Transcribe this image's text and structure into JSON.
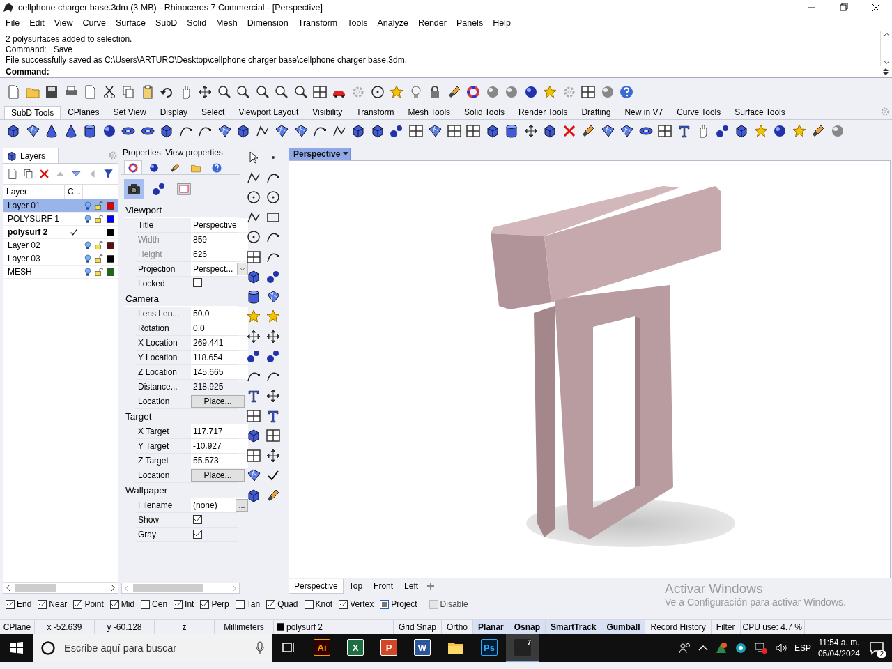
{
  "window": {
    "title": "cellphone charger base.3dm (3 MB) - Rhinoceros 7 Commercial - [Perspective]"
  },
  "menu": [
    "File",
    "Edit",
    "View",
    "Curve",
    "Surface",
    "SubD",
    "Solid",
    "Mesh",
    "Dimension",
    "Transform",
    "Tools",
    "Analyze",
    "Render",
    "Panels",
    "Help"
  ],
  "command_history": [
    "2 polysurfaces added to selection.",
    "Command: _Save",
    "File successfully saved as C:\\Users\\ARTURO\\Desktop\\cellphone charger base\\cellphone charger base.3dm."
  ],
  "command_prompt": "Command:",
  "toolbar_tabs": [
    {
      "label": "SubD Tools",
      "selected": true
    },
    {
      "label": "CPlanes",
      "selected": false
    },
    {
      "label": "Set View",
      "selected": false
    },
    {
      "label": "Display",
      "selected": false
    },
    {
      "label": "Select",
      "selected": false
    },
    {
      "label": "Viewport Layout",
      "selected": false
    },
    {
      "label": "Visibility",
      "selected": false
    },
    {
      "label": "Transform",
      "selected": false
    },
    {
      "label": "Mesh Tools",
      "selected": false
    },
    {
      "label": "Solid Tools",
      "selected": false
    },
    {
      "label": "Render Tools",
      "selected": false
    },
    {
      "label": "Drafting",
      "selected": false
    },
    {
      "label": "New in V7",
      "selected": false
    },
    {
      "label": "Curve Tools",
      "selected": false
    },
    {
      "label": "Surface Tools",
      "selected": false
    }
  ],
  "layers": {
    "title": "Layers",
    "columns": [
      "Layer",
      "C..."
    ],
    "rows": [
      {
        "name": "Layer 01",
        "selected": true,
        "current": false,
        "color": "#e00000"
      },
      {
        "name": "POLYSURF 1",
        "selected": false,
        "current": false,
        "color": "#0000ff"
      },
      {
        "name": "polysurf 2",
        "selected": false,
        "current": true,
        "color": "#000000"
      },
      {
        "name": "Layer 02",
        "selected": false,
        "current": false,
        "color": "#5a1010"
      },
      {
        "name": "Layer 03",
        "selected": false,
        "current": false,
        "color": "#000000"
      },
      {
        "name": "MESH",
        "selected": false,
        "current": false,
        "color": "#1a6a1a"
      }
    ]
  },
  "properties": {
    "title": "Properties: View properties",
    "tabs": [
      {
        "kind": "wheel",
        "selected": true
      },
      {
        "kind": "sphere",
        "selected": false
      },
      {
        "kind": "brush",
        "selected": false
      },
      {
        "kind": "folder",
        "selected": false
      },
      {
        "kind": "help",
        "selected": false
      }
    ],
    "pages": [
      {
        "kind": "camera",
        "selected": true
      },
      {
        "kind": "spheres",
        "selected": false
      },
      {
        "kind": "frame",
        "selected": false
      }
    ],
    "sections": [
      {
        "heading": "Viewport",
        "rows": [
          {
            "label": "Title",
            "kind": "text",
            "value": "Perspective",
            "disabled": false
          },
          {
            "label": "Width",
            "kind": "text",
            "value": "859",
            "disabled": true
          },
          {
            "label": "Height",
            "kind": "text",
            "value": "626",
            "disabled": true
          },
          {
            "label": "Projection",
            "kind": "dropdown",
            "value": "Perspect...",
            "disabled": false
          },
          {
            "label": "Locked",
            "kind": "checkbox",
            "checked": false,
            "disabled": false
          }
        ]
      },
      {
        "heading": "Camera",
        "rows": [
          {
            "label": "Lens Len...",
            "kind": "text",
            "value": "50.0",
            "disabled": false
          },
          {
            "label": "Rotation",
            "kind": "text",
            "value": "0.0",
            "disabled": false
          },
          {
            "label": "X Location",
            "kind": "text",
            "value": "269.441",
            "disabled": false
          },
          {
            "label": "Y Location",
            "kind": "text",
            "value": "118.654",
            "disabled": false
          },
          {
            "label": "Z Location",
            "kind": "text",
            "value": "145.665",
            "disabled": false
          },
          {
            "label": "Distance...",
            "kind": "static",
            "value": "218.925",
            "disabled": false
          },
          {
            "label": "Location",
            "kind": "button",
            "value": "Place...",
            "disabled": false
          }
        ]
      },
      {
        "heading": "Target",
        "rows": [
          {
            "label": "X Target",
            "kind": "text",
            "value": "117.717",
            "disabled": false
          },
          {
            "label": "Y Target",
            "kind": "text",
            "value": "-10.927",
            "disabled": false
          },
          {
            "label": "Z Target",
            "kind": "text",
            "value": "55.573",
            "disabled": false
          },
          {
            "label": "Location",
            "kind": "button",
            "value": "Place...",
            "disabled": false
          }
        ]
      },
      {
        "heading": "Wallpaper",
        "rows": [
          {
            "label": "Filename",
            "kind": "file",
            "value": "(none)",
            "button": "...",
            "disabled": false
          },
          {
            "label": "Show",
            "kind": "checkbox",
            "checked": true,
            "disabled": false
          },
          {
            "label": "Gray",
            "kind": "checkbox",
            "checked": true,
            "disabled": false
          }
        ]
      }
    ]
  },
  "viewport": {
    "label": "Perspective"
  },
  "view_tabs": [
    {
      "label": "Perspective",
      "selected": true
    },
    {
      "label": "Top",
      "selected": false
    },
    {
      "label": "Front",
      "selected": false
    },
    {
      "label": "Left",
      "selected": false
    }
  ],
  "osnaps": [
    {
      "label": "End",
      "checked": true
    },
    {
      "label": "Near",
      "checked": true
    },
    {
      "label": "Point",
      "checked": true
    },
    {
      "label": "Mid",
      "checked": true
    },
    {
      "label": "Cen",
      "checked": false
    },
    {
      "label": "Int",
      "checked": true
    },
    {
      "label": "Perp",
      "checked": true
    },
    {
      "label": "Tan",
      "checked": false
    },
    {
      "label": "Quad",
      "checked": true
    },
    {
      "label": "Knot",
      "checked": false
    },
    {
      "label": "Vertex",
      "checked": true
    }
  ],
  "project": {
    "label": "Project",
    "on": true
  },
  "disable": {
    "label": "Disable",
    "checked": false
  },
  "activation_notice": {
    "title": "Activar Windows",
    "text": "Ve a Configuración para activar Windows."
  },
  "status_bar": {
    "cplane": "CPlane",
    "x": "x -52.639",
    "y": "y -60.128",
    "z": "z",
    "units": "Millimeters",
    "layer": {
      "name": "polysurf 2",
      "color": "#000000"
    },
    "toggles": [
      {
        "label": "Grid Snap",
        "on": false
      },
      {
        "label": "Ortho",
        "on": false
      },
      {
        "label": "Planar",
        "on": true
      },
      {
        "label": "Osnap",
        "on": true
      },
      {
        "label": "SmartTrack",
        "on": true
      },
      {
        "label": "Gumball",
        "on": true
      },
      {
        "label": "Record History",
        "on": false
      },
      {
        "label": "Filter",
        "on": false
      }
    ],
    "cpu": "CPU use: 4.7 %"
  },
  "taskbar": {
    "search_placeholder": "Escribe aquí para buscar",
    "apps": [
      {
        "kind": "taskview",
        "selected": false
      },
      {
        "kind": "illustrator",
        "label": "Ai",
        "selected": false
      },
      {
        "kind": "excel",
        "label": "X",
        "selected": false
      },
      {
        "kind": "powerpoint",
        "label": "P",
        "selected": false
      },
      {
        "kind": "word",
        "label": "W",
        "selected": false
      },
      {
        "kind": "explorer",
        "selected": false
      },
      {
        "kind": "photoshop",
        "label": "Ps",
        "selected": false
      },
      {
        "kind": "rhino",
        "label": "7",
        "selected": true
      }
    ],
    "language": "ESP",
    "time": "11:54 a. m.",
    "date": "05/04/2024",
    "notifications": "2"
  }
}
